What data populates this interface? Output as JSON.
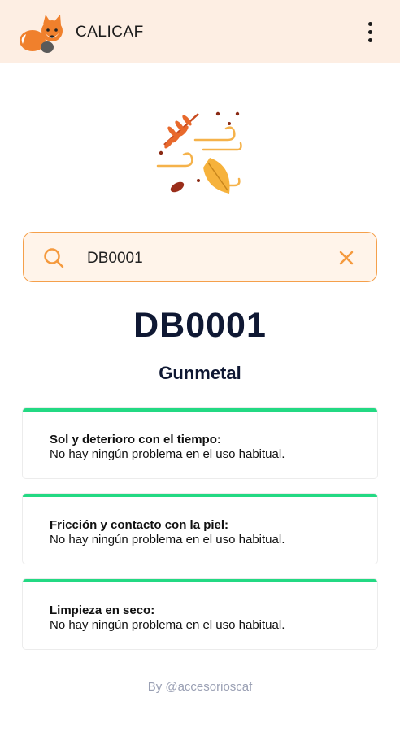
{
  "app": {
    "title": "CALICAF"
  },
  "search": {
    "value": "DB0001"
  },
  "result": {
    "code": "DB0001",
    "color_name": "Gunmetal"
  },
  "cards": [
    {
      "title": "Sol y deterioro con el tiempo:",
      "text": "No hay ningún problema en el uso habitual."
    },
    {
      "title": "Fricción y contacto con la piel:",
      "text": "No hay ningún problema en el uso habitual."
    },
    {
      "title": "Limpieza en seco:",
      "text": "No hay ningún problema en el uso habitual."
    }
  ],
  "footer": {
    "text": "By @accesorioscaf"
  },
  "icons": {
    "logo": "fox-logo-icon",
    "menu": "more-vertical-icon",
    "search": "search-icon",
    "clear": "close-icon",
    "hero": "autumn-leaves-icon"
  },
  "colors": {
    "accent": "#f5a04b",
    "appbar": "#fdeee3",
    "success": "#23d983",
    "heading": "#0f1833"
  }
}
